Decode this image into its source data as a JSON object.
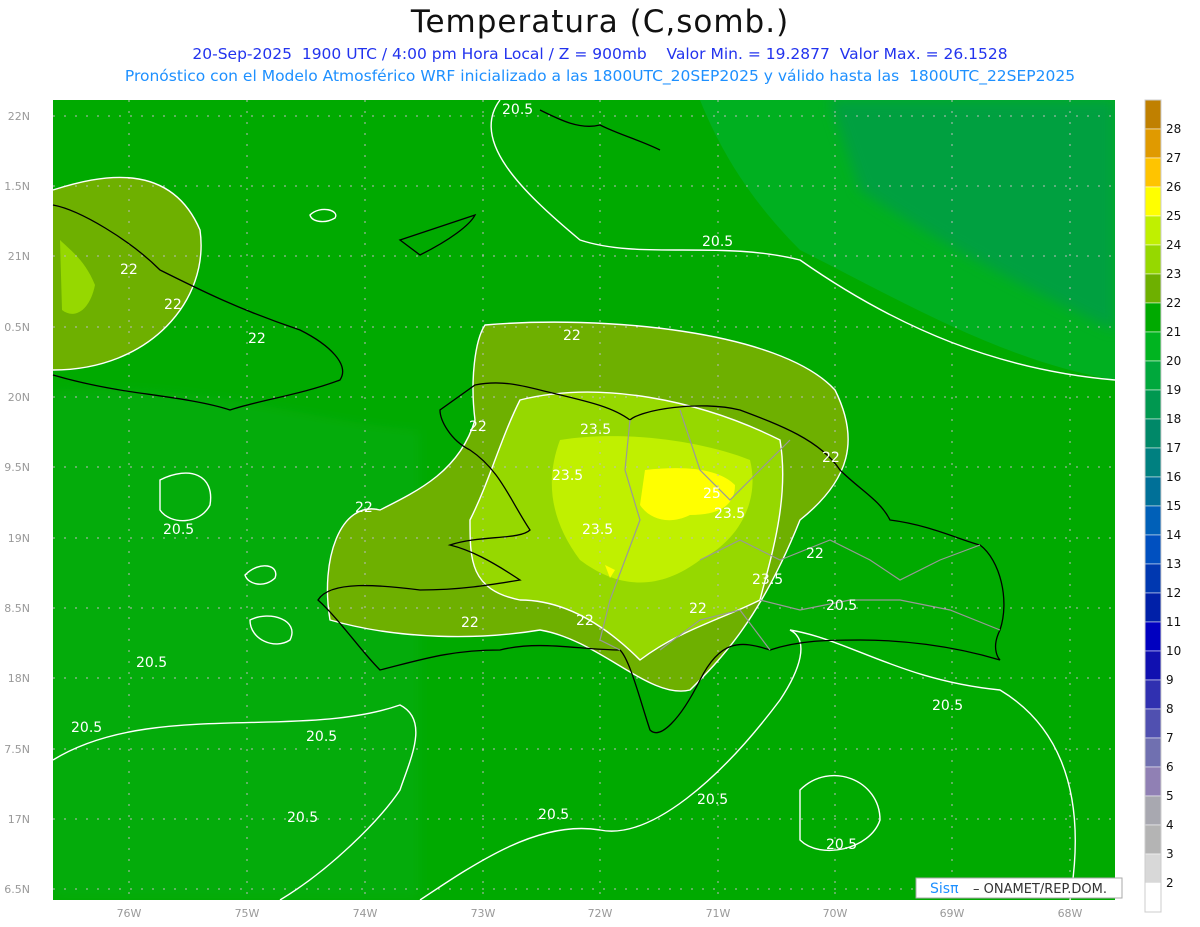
{
  "title": "Temperatura (C,somb.)",
  "subtitle_line1": "20-Sep-2025  1900 UTC / 4:00 pm Hora Local / Z = 900mb    Valor Min. = 19.2877  Valor Max. = 26.1528",
  "subtitle_line2": "Pronóstico con el Modelo Atmosférico WRF inicializado a las 1800UTC_20SEP2025 y válido hasta las  1800UTC_22SEP2025",
  "axes": {
    "lon_labels": [
      "76W",
      "75W",
      "74W",
      "73W",
      "72W",
      "71W",
      "70W",
      "69W",
      "68W"
    ],
    "lat_labels": [
      "22N",
      "1.5N",
      "21N",
      "0.5N",
      "20N",
      "9.5N",
      "19N",
      "8.5N",
      "18N",
      "7.5N",
      "17N",
      "6.5N"
    ]
  },
  "contour_labels": [
    "20.5",
    "22",
    "22",
    "22",
    "20.5",
    "22",
    "23.5",
    "23.5",
    "22",
    "25",
    "23.5",
    "23.5",
    "22",
    "22",
    "23.5",
    "22",
    "22",
    "22",
    "20.5",
    "20.5",
    "20.5",
    "20.5",
    "20.5",
    "20.5",
    "20.5",
    "20.5",
    "20.5",
    "20.5",
    "22",
    "22"
  ],
  "legend": {
    "labels": [
      "28",
      "27",
      "26",
      "25",
      "24",
      "23",
      "22",
      "21",
      "20",
      "19",
      "18",
      "17",
      "16",
      "15",
      "14",
      "13",
      "12",
      "11",
      "10",
      "9",
      "8",
      "7",
      "6",
      "5",
      "4",
      "3",
      "2"
    ],
    "colors": [
      "#c08000",
      "#e09a00",
      "#ffc400",
      "#ffff00",
      "#c0f000",
      "#96d800",
      "#6eb000",
      "#00aa00",
      "#00b420",
      "#00a83c",
      "#009850",
      "#008868",
      "#008080",
      "#007098",
      "#0060b8",
      "#0050c0",
      "#0038b0",
      "#0020a8",
      "#0000c0",
      "#1010b0",
      "#3030b0",
      "#5050b0",
      "#7070b0",
      "#9080b4",
      "#a8a8b0",
      "#b4b4b4",
      "#d8d8d8"
    ],
    "bottom_color": "#ffffff"
  },
  "credit": {
    "brand": "Sisπ",
    "text": "– ONAMET/REP.DOM."
  }
}
